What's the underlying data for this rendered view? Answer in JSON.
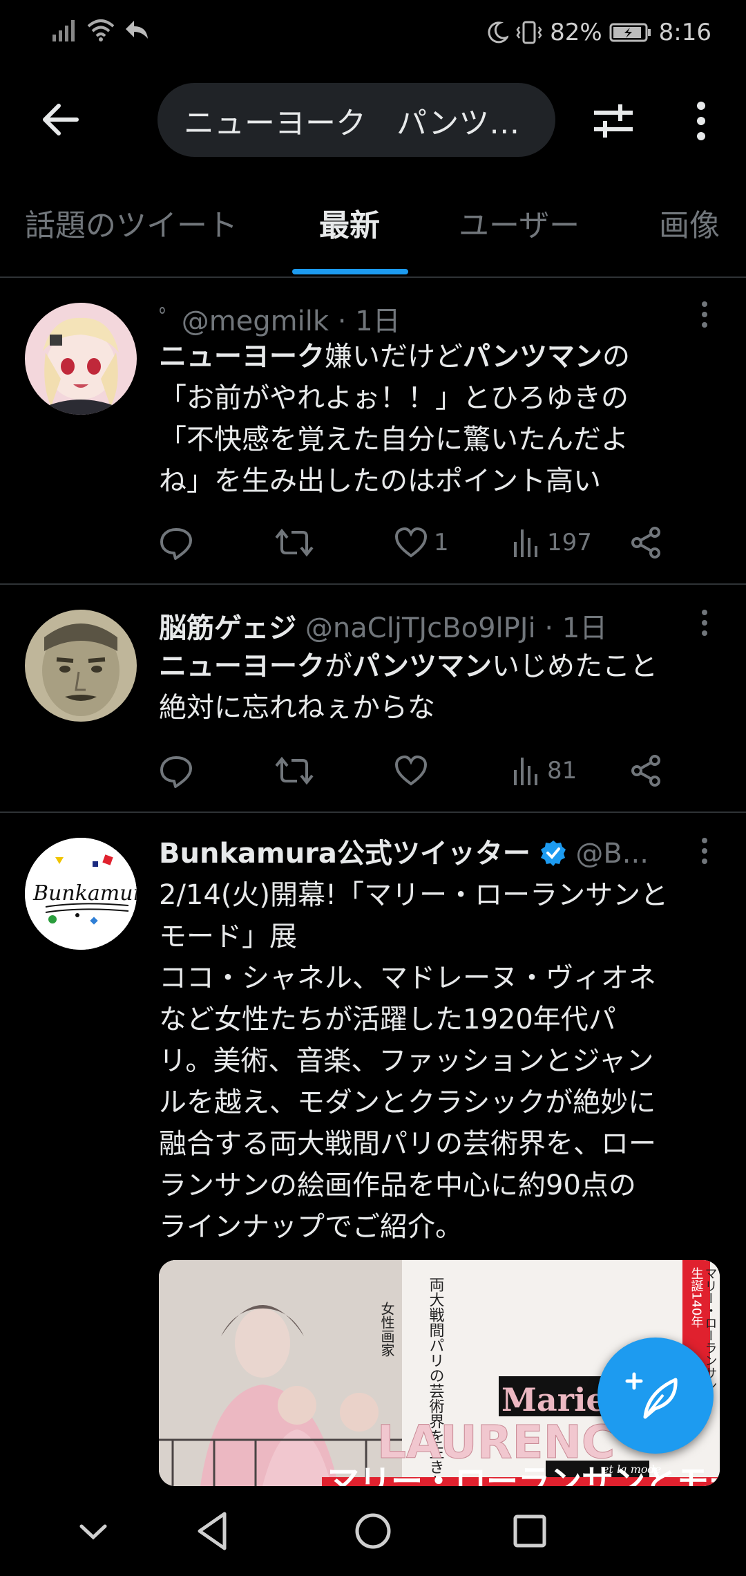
{
  "status": {
    "battery": "82%",
    "time": "8:16"
  },
  "header": {
    "search_query": "ニューヨーク　パンツ…"
  },
  "tabs": [
    "話題のツイート",
    "最新",
    "ユーザー",
    "画像"
  ],
  "tweets": [
    {
      "display_name": "",
      "prefix_mark": "ﾟ",
      "handle": "@megmilk",
      "time": "· 1日",
      "lines": [
        [
          {
            "t": "ニューヨーク",
            "b": true
          },
          {
            "t": "嫌いだけど",
            "b": false
          },
          {
            "t": "パンツマン",
            "b": true
          },
          {
            "t": "の",
            "b": false
          }
        ],
        [
          {
            "t": "「お前がやれよぉ！！」とひろゆきの",
            "b": false
          }
        ],
        [
          {
            "t": "「不快感を覚えた自分に驚いたんだよ",
            "b": false
          }
        ],
        [
          {
            "t": "ね」を生み出したのはポイント高い",
            "b": false
          }
        ]
      ],
      "likes": "1",
      "views": "197"
    },
    {
      "display_name": "脳筋ゲェジ",
      "handle": "@naCljTJcBo9lPJi",
      "time": "· 1日",
      "lines": [
        [
          {
            "t": "ニューヨーク",
            "b": true
          },
          {
            "t": "が",
            "b": false
          },
          {
            "t": "パンツマン",
            "b": true
          },
          {
            "t": "いじめたこと",
            "b": false
          }
        ],
        [
          {
            "t": "絶対に忘れねぇからな",
            "b": false
          }
        ]
      ],
      "likes": "",
      "views": "81"
    },
    {
      "display_name": "Bunkamura公式ツイッター",
      "handle": "@B...",
      "verified": true,
      "lines": [
        [
          {
            "t": "2/14(火)開幕!「マリー・ローランサンと",
            "b": false
          }
        ],
        [
          {
            "t": "モード」展",
            "b": false
          }
        ],
        [
          {
            "t": "ココ・シャネル、マドレーヌ・ヴィオネ",
            "b": false
          }
        ],
        [
          {
            "t": "など女性たちが活躍した1920年代パ",
            "b": false
          }
        ],
        [
          {
            "t": "リ。美術、音楽、ファッションとジャン",
            "b": false
          }
        ],
        [
          {
            "t": "ルを越え、モダンとクラシックが絶妙に",
            "b": false
          }
        ],
        [
          {
            "t": "融合する両大戦間パリの芸術界を、ロー",
            "b": false
          }
        ],
        [
          {
            "t": "ランサンの絵画作品を中心に約90点の",
            "b": false
          }
        ],
        [
          {
            "t": "ラインナップでご紹介。",
            "b": false
          }
        ]
      ],
      "media": {
        "poster_title_ja": "両大戦間パリの芸術界を生きた",
        "poster_sub_ja": "女性画家",
        "poster_side_ja": "生誕140年",
        "poster_side_ja2": "マリー・ローランサン",
        "poster_name_1": "Marie",
        "poster_name_2": "LAURENC",
        "poster_tagline": "et la mode",
        "poster_bottom_ja": "マリー・ローランサンとモード"
      }
    }
  ],
  "colors": {
    "accent": "#1d9bf0",
    "bg": "#000000",
    "muted": "#71767b"
  }
}
